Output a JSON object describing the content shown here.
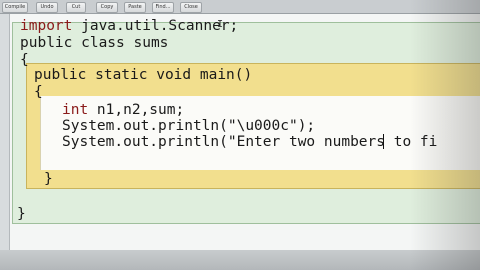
{
  "toolbar": {
    "buttons": [
      "Compile",
      "Undo",
      "Cut",
      "Copy",
      "Paste",
      "Find...",
      "Close"
    ]
  },
  "code": {
    "line1_kw": "import",
    "line1_rest": " java.util.Scanner;",
    "line2": "public class sums",
    "line3": "{",
    "line4": "public static void main()",
    "line5": "{",
    "line6_kw": "int",
    "line6_rest": " n1,n2,sum;",
    "line7": "System.out.println(\"\\u000c\");",
    "line8": "System.out.println(\"Enter two numbers to fi",
    "line9": "}",
    "line10": "}"
  },
  "colors": {
    "keyword": "#8a1a1a",
    "class_scope": "#dfeedd",
    "method_scope": "#f2df8e",
    "body_scope": "#fbfbf8"
  }
}
